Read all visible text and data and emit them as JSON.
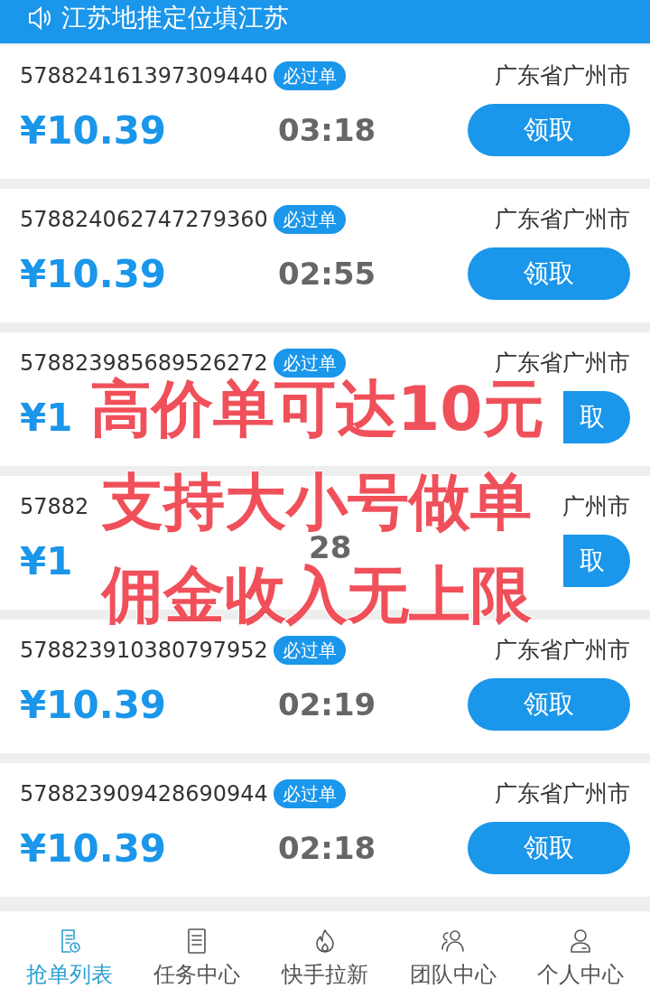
{
  "notice": {
    "text": "江苏地推定位填江苏"
  },
  "orders": [
    {
      "id": "578824161397309440",
      "badge": "必过单",
      "location": "广东省广州市",
      "price": "¥10.39",
      "time": "03:18",
      "button": "领取",
      "covered": false
    },
    {
      "id": "578824062747279360",
      "badge": "必过单",
      "location": "广东省广州市",
      "price": "¥10.39",
      "time": "02:55",
      "button": "领取",
      "covered": false
    },
    {
      "id": "578823985689526272",
      "badge": "必过单",
      "location": "广东省广州市",
      "price": "¥1",
      "button": "取",
      "covered": true
    },
    {
      "id": "57882",
      "location": "广州市",
      "price": "¥1",
      "time": "28",
      "button": "取",
      "covered": true
    },
    {
      "id": "578823910380797952",
      "badge": "必过单",
      "location": "广东省广州市",
      "price": "¥10.39",
      "time": "02:19",
      "button": "领取",
      "covered": false
    },
    {
      "id": "578823909428690944",
      "badge": "必过单",
      "location": "广东省广州市",
      "price": "¥10.39",
      "time": "02:18",
      "button": "领取",
      "covered": false
    }
  ],
  "promo": [
    "高价单可达10元",
    "支持大小号做单",
    "佣金收入无上限"
  ],
  "tabs": [
    {
      "label": "抢单列表",
      "kind": "list",
      "selected": true
    },
    {
      "label": "任务中心",
      "kind": "doc",
      "selected": false
    },
    {
      "label": "快手拉新",
      "kind": "flame",
      "selected": false
    },
    {
      "label": "团队中心",
      "kind": "team",
      "selected": false
    },
    {
      "label": "个人中心",
      "kind": "user",
      "selected": false
    }
  ]
}
